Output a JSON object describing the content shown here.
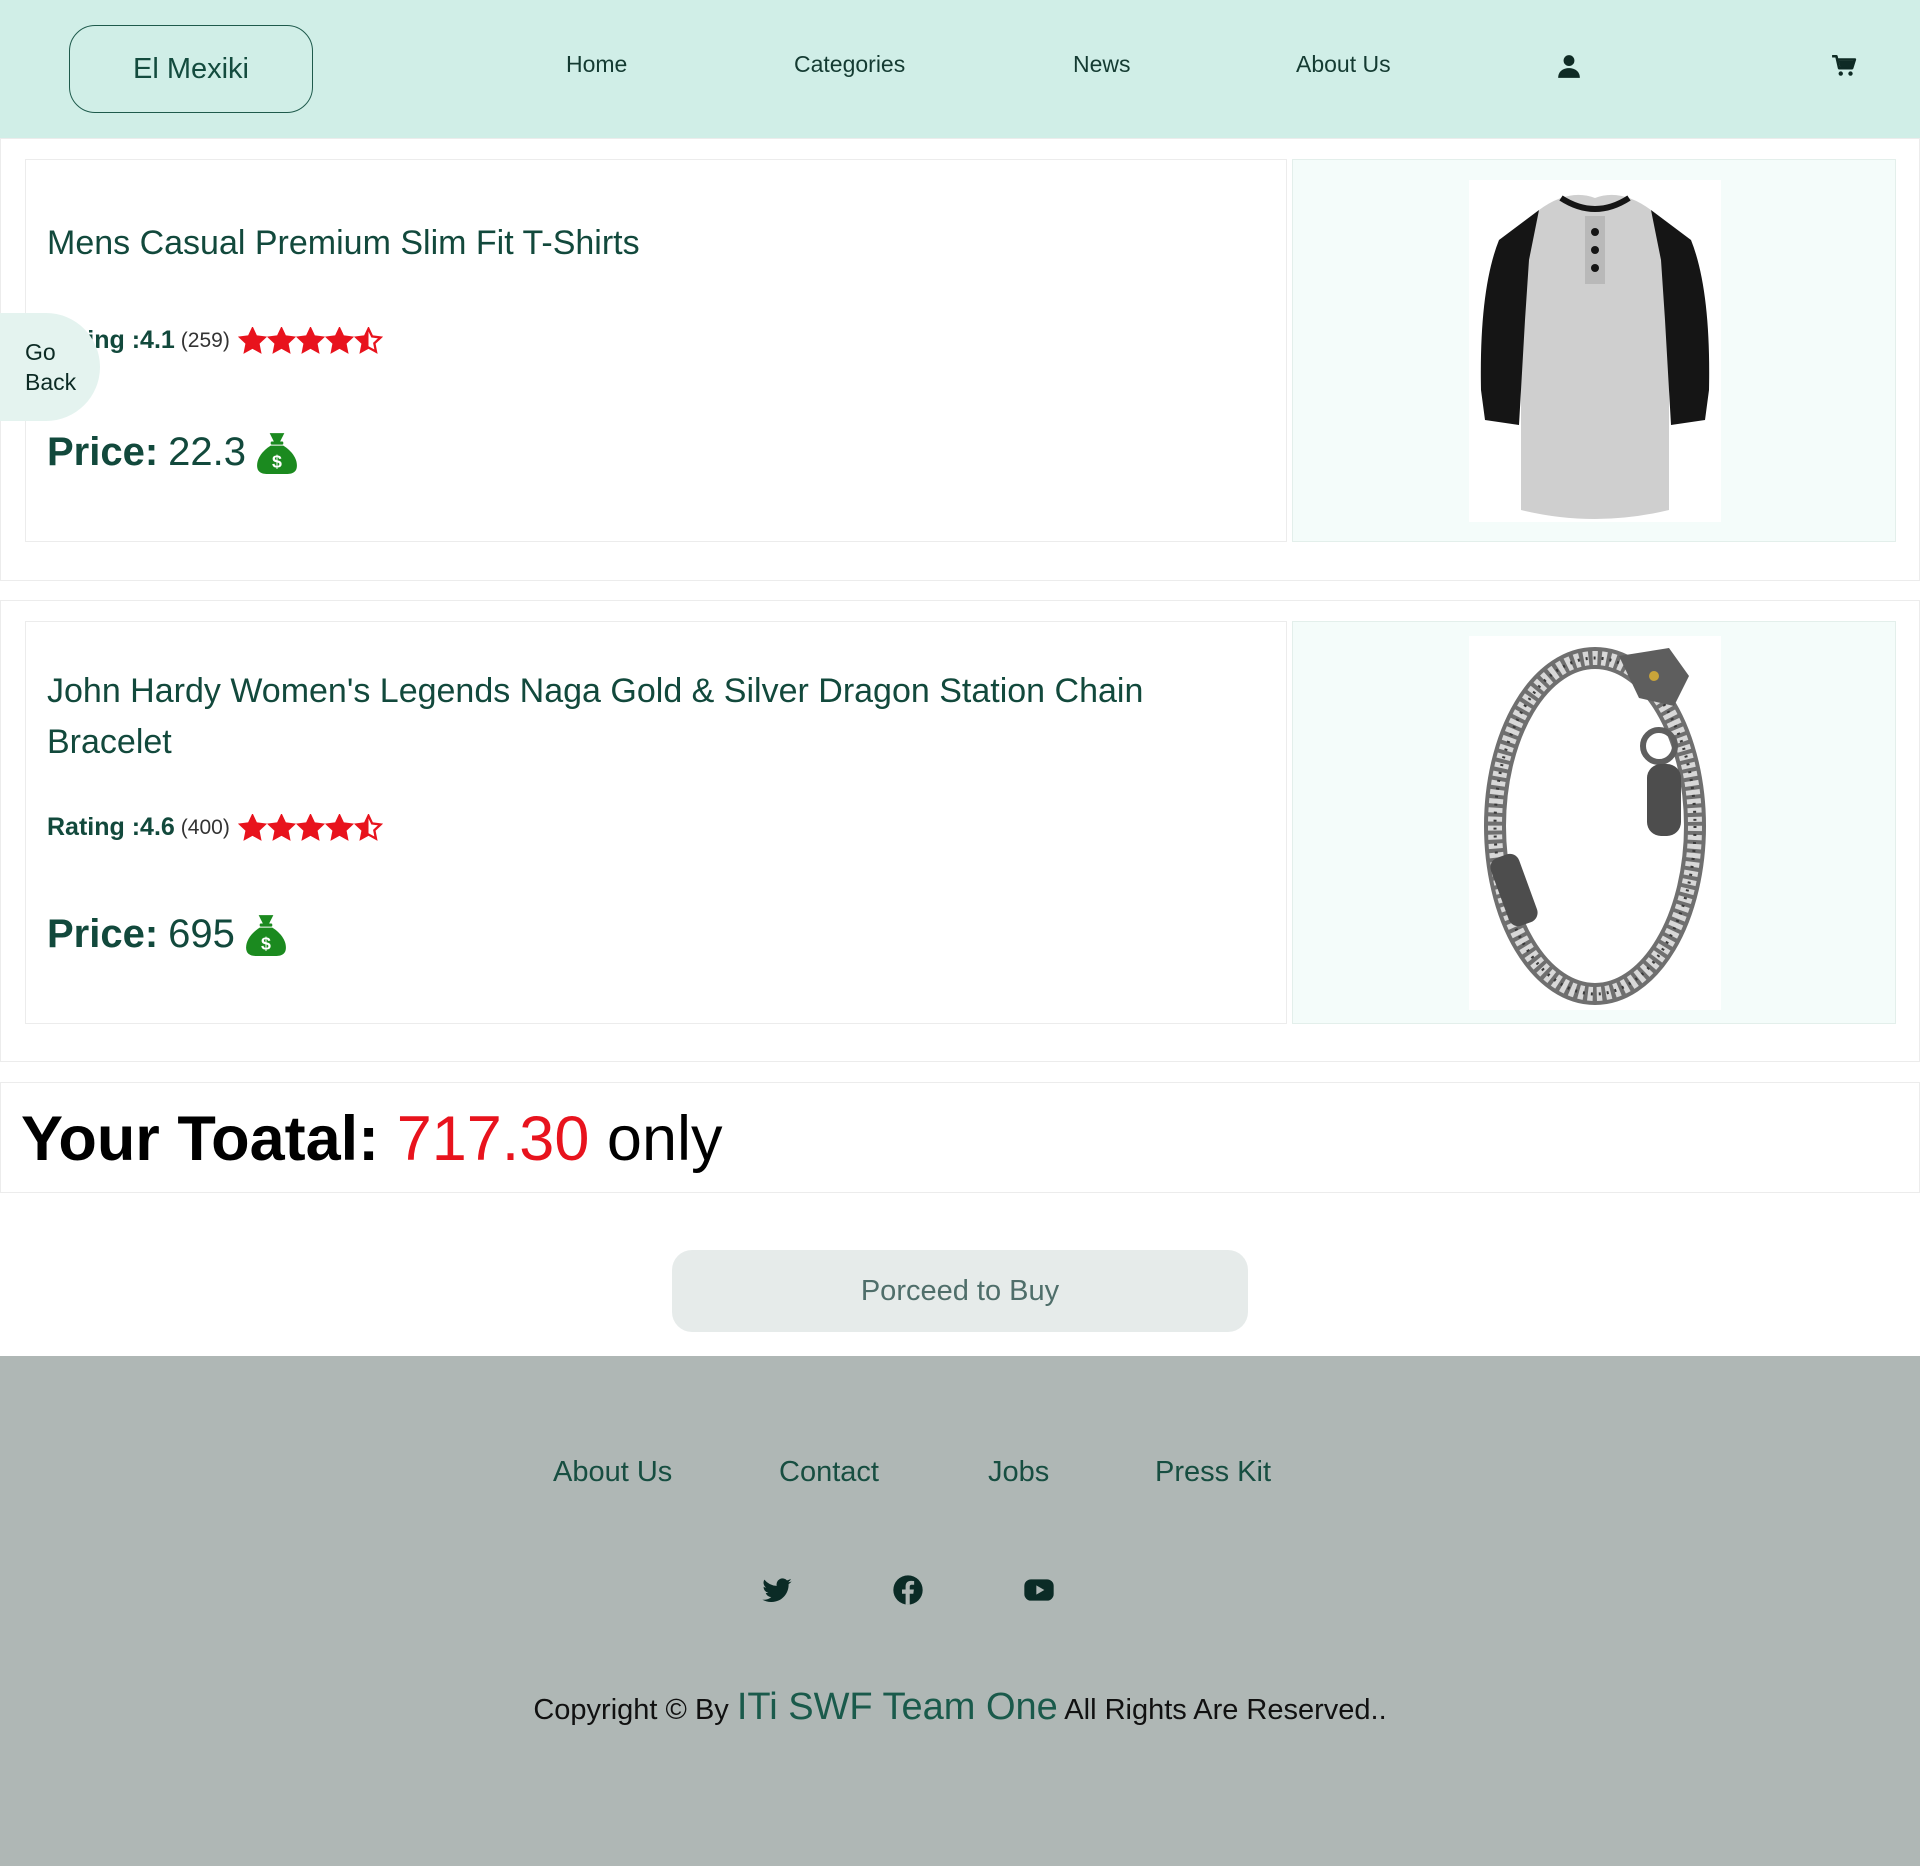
{
  "header": {
    "brand": "El Mexiki",
    "nav": [
      "Home",
      "Categories",
      "News",
      "About Us"
    ],
    "icons": [
      "user-icon",
      "cart-icon"
    ]
  },
  "go_back": {
    "line1": "Go",
    "line2": "Back"
  },
  "products": [
    {
      "title": "Mens Casual Premium Slim Fit T-Shirts",
      "rating_label": "Rating :4.1",
      "rating": 4.1,
      "rating_count": "(259)",
      "price_label": "Price:",
      "price": "22.3"
    },
    {
      "title": "John Hardy Women's Legends Naga Gold & Silver Dragon Station Chain Bracelet",
      "rating_label": "Rating :4.6",
      "rating": 4.6,
      "rating_count": "(400)",
      "price_label": "Price:",
      "price": "695"
    }
  ],
  "total": {
    "label": "Your Toatal:",
    "value": "717.30",
    "suffix": "only"
  },
  "buy_button": "Porceed to Buy",
  "footer": {
    "links": [
      "About Us",
      "Contact",
      "Jobs",
      "Press Kit"
    ],
    "social": [
      "twitter-icon",
      "facebook-icon",
      "youtube-icon"
    ],
    "copyright_prefix": "Copyright © By",
    "team": "ITi SWF Team One",
    "copyright_suffix": "All Rights Are Reserved.."
  },
  "colors": {
    "header_bg": "#d0eee7",
    "footer_bg": "#afb7b5",
    "accent_green": "#12493c",
    "star_red": "#e8131d",
    "money_green": "#1b8a1f"
  }
}
